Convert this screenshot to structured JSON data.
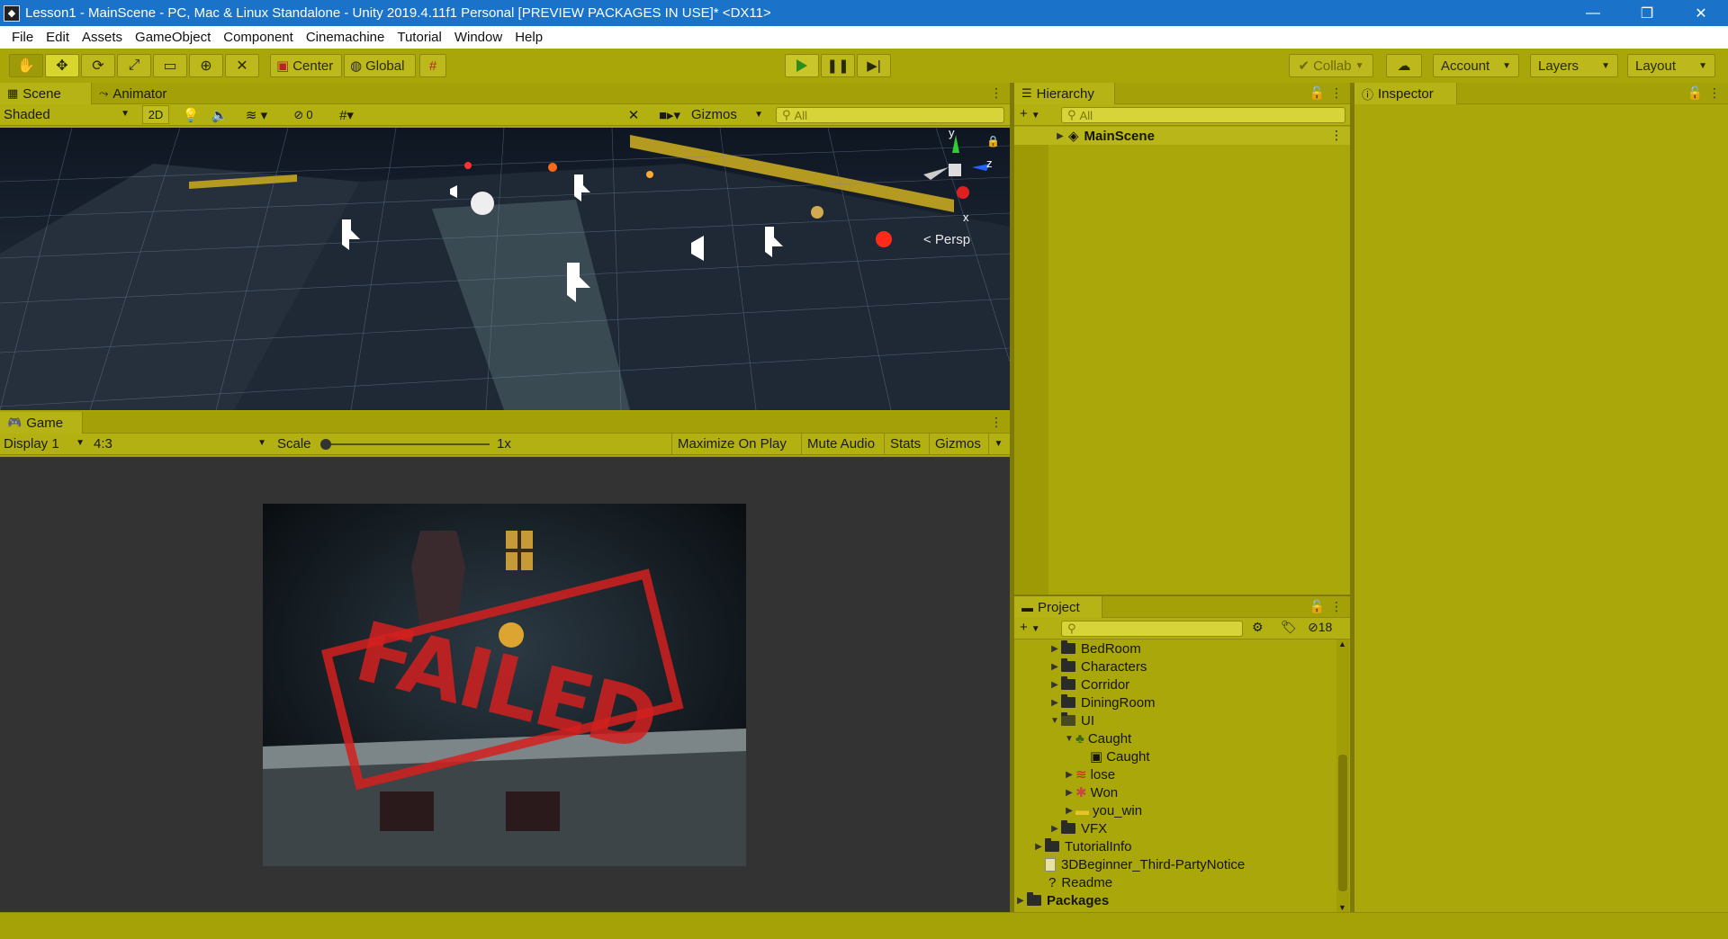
{
  "window": {
    "title": "Lesson1 - MainScene - PC, Mac & Linux Standalone - Unity 2019.4.11f1 Personal [PREVIEW PACKAGES IN USE]* <DX11>",
    "minimize": "—",
    "restore": "❐",
    "close": "✕"
  },
  "menu": [
    "File",
    "Edit",
    "Assets",
    "GameObject",
    "Component",
    "Cinemachine",
    "Tutorial",
    "Window",
    "Help"
  ],
  "toolbar": {
    "pivot_label": "Center",
    "space_label": "Global",
    "collab_label": "Collab",
    "account_label": "Account",
    "layers_label": "Layers",
    "layout_label": "Layout"
  },
  "scene_panel": {
    "tab_scene": "Scene",
    "tab_animator": "Animator",
    "shading_mode": "Shaded",
    "mode_2d": "2D",
    "hidden_count": "0",
    "gizmos_label": "Gizmos",
    "search_placeholder": "All",
    "gizmo_y": "y",
    "gizmo_z": "z",
    "gizmo_x": "x",
    "projection_label": "< Persp"
  },
  "game_panel": {
    "tab_game": "Game",
    "display": "Display 1",
    "aspect": "4:3",
    "scale_label": "Scale",
    "scale_value": "1x",
    "maximize_on_play": "Maximize On Play",
    "mute_audio": "Mute Audio",
    "stats": "Stats",
    "gizmos": "Gizmos",
    "stamp_text": "FAILED"
  },
  "hierarchy": {
    "tab": "Hierarchy",
    "search_placeholder": "All",
    "root_item": "MainScene"
  },
  "inspector": {
    "tab": "Inspector"
  },
  "project": {
    "tab": "Project",
    "hidden_packages_count": "18",
    "items": [
      {
        "label": "BedRoom",
        "type": "folder",
        "expanded": false
      },
      {
        "label": "Characters",
        "type": "folder",
        "expanded": false
      },
      {
        "label": "Corridor",
        "type": "folder",
        "expanded": false
      },
      {
        "label": "DiningRoom",
        "type": "folder",
        "expanded": false
      },
      {
        "label": "UI",
        "type": "folder",
        "expanded": true
      },
      {
        "label": "Caught",
        "type": "sprite",
        "expanded": true
      },
      {
        "label": "Caught",
        "type": "sprite-child"
      },
      {
        "label": "lose",
        "type": "sprite",
        "expanded": false
      },
      {
        "label": "Won",
        "type": "sprite",
        "expanded": false
      },
      {
        "label": "you_win",
        "type": "sprite",
        "expanded": false
      },
      {
        "label": "VFX",
        "type": "folder",
        "expanded": false
      },
      {
        "label": "TutorialInfo",
        "type": "folder",
        "expanded": false
      },
      {
        "label": "3DBeginner_Third-PartyNotice",
        "type": "text"
      },
      {
        "label": "Readme",
        "type": "asset"
      },
      {
        "label": "Packages",
        "type": "folder",
        "expanded": false
      }
    ]
  },
  "colors": {
    "title_bar": "#1a73c9",
    "editor_tint": "#a7a508",
    "play_icon": "#2e8b1c",
    "failed_stamp": "#d3201f"
  }
}
